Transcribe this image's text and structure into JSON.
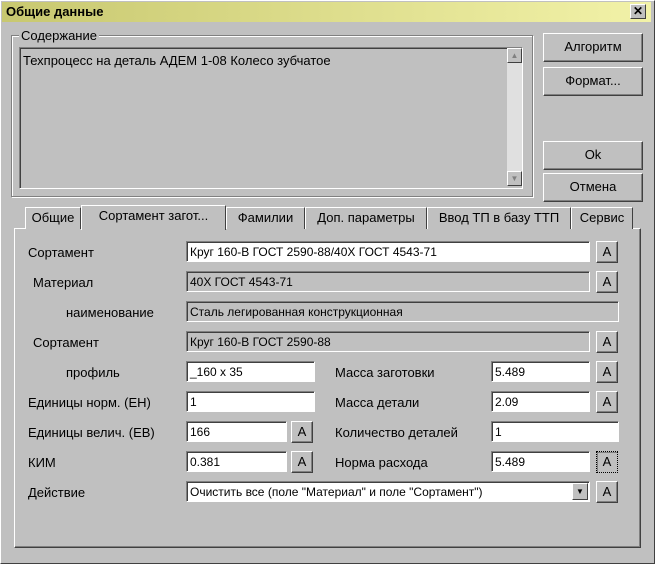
{
  "window": {
    "title": "Общие данные",
    "close_glyph": "✕"
  },
  "content_group": {
    "label": "Содержание",
    "text": "Техпроцесс на деталь АДЕМ 1-08 Колесо зубчатое"
  },
  "buttons": {
    "algorithm": "Алгоритм",
    "format": "Формат...",
    "ok": "Ok",
    "cancel": "Отмена"
  },
  "tabs": [
    {
      "label": "Общие"
    },
    {
      "label": "Сортамент загот..."
    },
    {
      "label": "Фамилии"
    },
    {
      "label": "Доп. параметры"
    },
    {
      "label": "Ввод ТП в базу ТТП"
    },
    {
      "label": "Сервис"
    }
  ],
  "active_tab": 1,
  "form": {
    "sortament": {
      "label": "Сортамент",
      "value": "Круг 160-В ГОСТ 2590-88/40Х ГОСТ 4543-71"
    },
    "material": {
      "label": "Материал",
      "value": "40Х ГОСТ 4543-71"
    },
    "naimenovanie": {
      "label": "наименование",
      "value": "Сталь легированная конструкционная"
    },
    "sortament2": {
      "label": "Сортамент",
      "value": "Круг 160-В ГОСТ 2590-88"
    },
    "profil": {
      "label": "профиль",
      "value": "_160 x 35"
    },
    "massa_zagotovki": {
      "label": "Масса заготовки",
      "value": "5.489"
    },
    "edinicy_norm": {
      "label": "Единицы норм. (ЕН)",
      "value": "1"
    },
    "massa_detali": {
      "label": "Масса детали",
      "value": "2.09"
    },
    "edinicy_velich": {
      "label": "Единицы велич. (ЕВ)",
      "value": "166"
    },
    "kolichestvo": {
      "label": "Количество деталей",
      "value": "1"
    },
    "kim": {
      "label": "КИМ",
      "value": "0.381"
    },
    "norma": {
      "label": "Норма расхода",
      "value": "5.489"
    },
    "deistvie": {
      "label": "Действие",
      "value": "Очистить все (поле \"Материал\" и поле \"Сортамент\")"
    },
    "a_label": "А"
  },
  "colors": {
    "face": "#c0c0c0",
    "title_grad_start": "#c8c870",
    "title_grad_end": "#f2f2a8"
  }
}
